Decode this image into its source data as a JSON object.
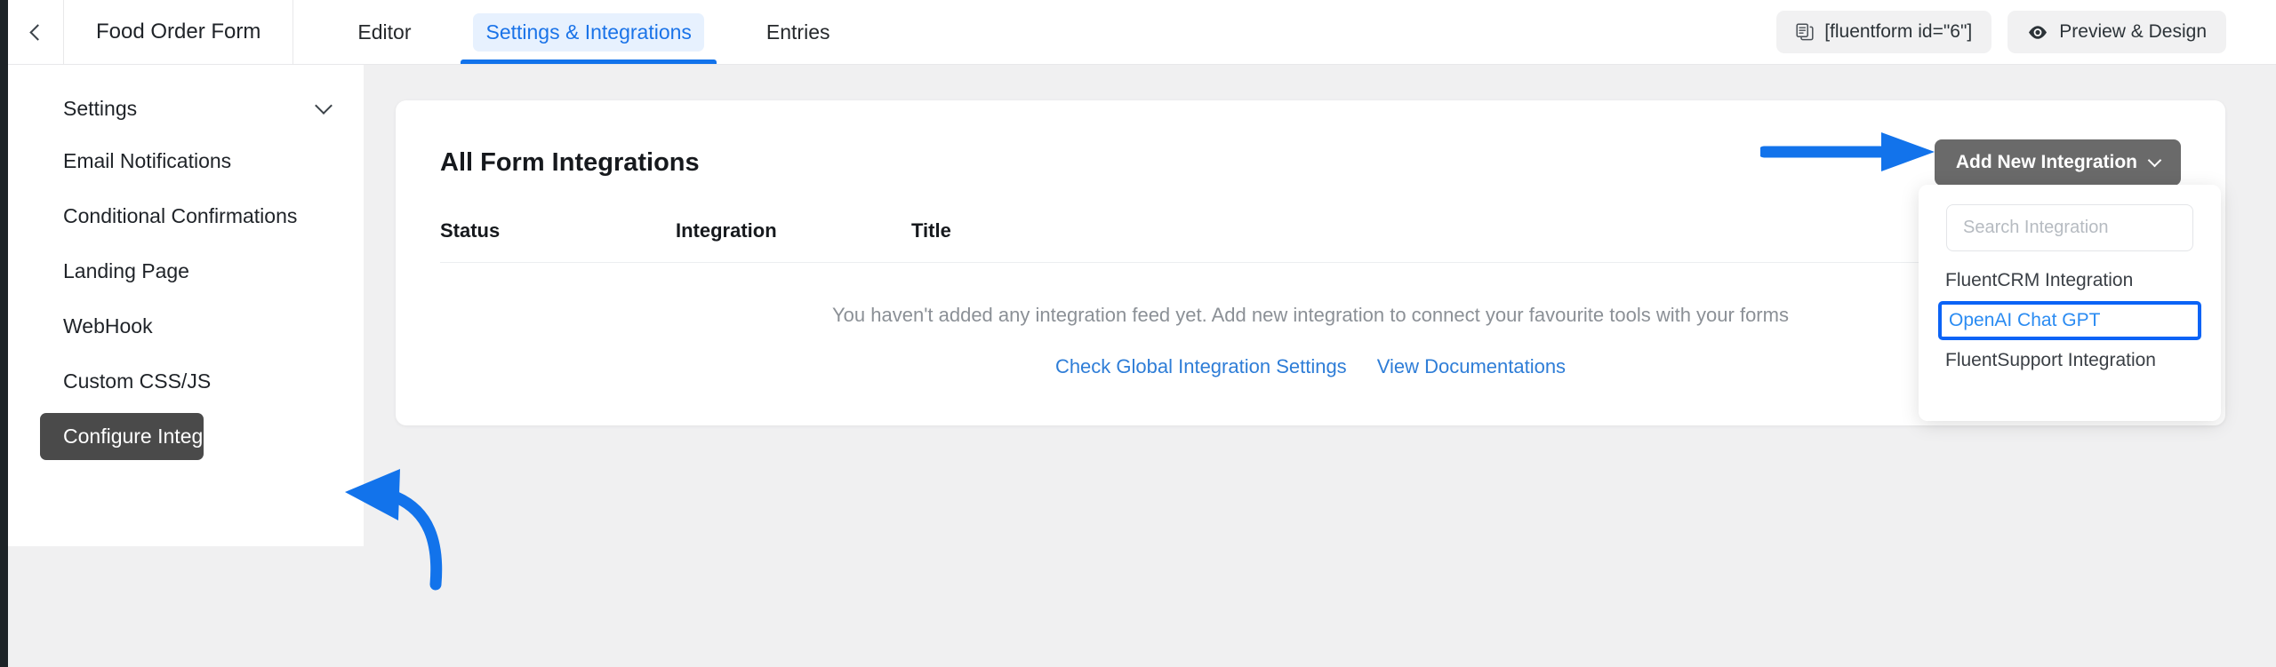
{
  "topbar": {
    "back_icon": "chevron-left-icon",
    "form_title": "Food Order Form",
    "tabs": [
      {
        "label": "Editor",
        "active": false
      },
      {
        "label": "Settings & Integrations",
        "active": true
      },
      {
        "label": "Entries",
        "active": false
      }
    ],
    "shortcode_button": {
      "label": "[fluentform id=\"6\"]",
      "icon": "copy-icon"
    },
    "preview_button": {
      "label": "Preview & Design",
      "icon": "eye-icon"
    }
  },
  "sidebar": {
    "heading": "Settings",
    "heading_icon": "chevron-down-icon",
    "items": [
      {
        "label": "Email Notifications",
        "active": false
      },
      {
        "label": "Conditional Confirmations",
        "active": false
      },
      {
        "label": "Landing Page",
        "active": false
      },
      {
        "label": "WebHook",
        "active": false
      },
      {
        "label": "Custom CSS/JS",
        "active": false
      },
      {
        "label": "Configure Integrations",
        "active": true
      }
    ]
  },
  "card": {
    "title": "All Form Integrations",
    "add_button": {
      "label": "Add New Integration",
      "icon": "chevron-down-icon"
    },
    "table": {
      "columns": [
        "Status",
        "Integration",
        "Title"
      ],
      "rows": []
    },
    "empty_state": {
      "message": "You haven't added any integration feed yet. Add new integration to connect your favourite tools with your forms",
      "links": [
        "Check Global Integration Settings",
        "View Documentations"
      ]
    }
  },
  "dropdown": {
    "search_placeholder": "Search Integration",
    "search_value": "",
    "items": [
      {
        "label": "FluentCRM Integration",
        "highlighted": false
      },
      {
        "label": "OpenAI Chat GPT",
        "highlighted": true
      },
      {
        "label": "FluentSupport Integration",
        "highlighted": false
      }
    ]
  },
  "annotations": {
    "color": "#1273eb",
    "arrow_to_add_button": "straight-arrow-right",
    "arrow_to_configure_integrations": "curved-arrow-up-left"
  },
  "colors": {
    "accent": "#1273eb",
    "link": "#2e7dd7",
    "active_item_bg": "#4a4a4a",
    "page_bg": "#f0f0f1"
  }
}
